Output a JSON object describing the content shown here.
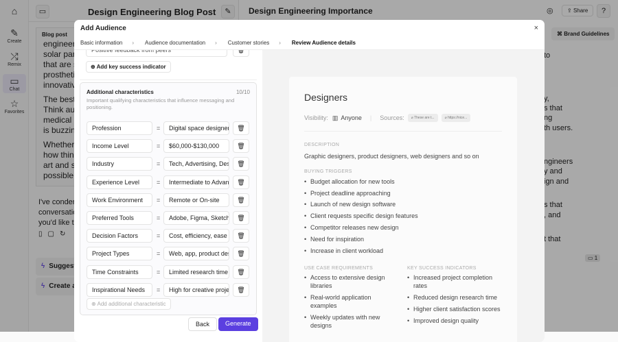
{
  "rail": [
    {
      "label": "",
      "icon": "home-icon",
      "glyph": "⌂"
    },
    {
      "label": "Create",
      "icon": "pen-icon",
      "glyph": "✎"
    },
    {
      "label": "Remix",
      "icon": "shuffle-icon",
      "glyph": "⤮"
    },
    {
      "label": "Chat",
      "icon": "chat-icon",
      "glyph": "💬"
    },
    {
      "label": "Favorites",
      "icon": "star-icon",
      "glyph": "☆"
    }
  ],
  "left_panel": {
    "title": "Design Engineering Blog Post",
    "blog_label": "Blog post",
    "paragraphs": [
      "engineers\nsolar pane\nthat are su\nprosthetic\ninnovative",
      "The best p\nThink auto\nmedical de\nis buzzing",
      "Whether y\nhow thing\nart and sc\npossible!"
    ],
    "chat_text": "I've conden\nconversatio\nyou'd like to",
    "suggestions": [
      "Suggest",
      "Create ar"
    ]
  },
  "right_panel": {
    "title": "Design Engineering Importance",
    "share": "Share",
    "brand_guidelines": "Brand Guidelines",
    "fragments": [
      "to",
      "y,",
      "s that",
      "ng",
      "th users.",
      "ngineers",
      "y and",
      "ign and",
      "s that",
      ", and",
      "t that"
    ],
    "comment_count": "1"
  },
  "modal": {
    "title": "Add Audience",
    "close": "×",
    "steps": [
      "Basic information",
      "Audience documentation",
      "Customer stories",
      "Review Audience details"
    ],
    "partial_indicator": "Positive feedback from peers",
    "add_indicator": "Add key success indicator",
    "additional": {
      "title": "Additional characteristics",
      "count": "10/10",
      "description": "Important qualifying characteristics that influence messaging and positioning.",
      "rows": [
        [
          "Profession",
          "Digital space designers"
        ],
        [
          "Income Level",
          "$60,000-$130,000"
        ],
        [
          "Industry",
          "Tech, Advertising, Design"
        ],
        [
          "Experience Level",
          "Intermediate to Advanced"
        ],
        [
          "Work Environment",
          "Remote or On-site"
        ],
        [
          "Preferred Tools",
          "Adobe, Figma, Sketch"
        ],
        [
          "Decision Factors",
          "Cost, efficiency, ease of use"
        ],
        [
          "Project Types",
          "Web, app, product design"
        ],
        [
          "Time Constraints",
          "Limited research time"
        ],
        [
          "Inspirational Needs",
          "High for creative projects"
        ]
      ],
      "add_label": "Add additional characteristic"
    },
    "back": "Back",
    "generate": "Generate",
    "preview": {
      "name": "Designers",
      "visibility_label": "Visibility:",
      "visibility": "Anyone",
      "sources_label": "Sources:",
      "sources": [
        "These are t...",
        "https://nice..."
      ],
      "description_label": "DESCRIPTION",
      "description": "Graphic designers, product designers, web designers and so on",
      "triggers_label": "BUYING TRIGGERS",
      "triggers": [
        "Budget allocation for new tools",
        "Project deadline approaching",
        "Launch of new design software",
        "Client requests specific design features",
        "Competitor releases new design",
        "Need for inspiration",
        "Increase in client workload"
      ],
      "use_case_label": "USE CASE REQUIREMENTS",
      "use_cases": [
        "Access to extensive design libraries",
        "Real-world application examples",
        "Weekly updates with new designs"
      ],
      "ksi_label": "KEY SUCCESS INDICATORS",
      "ksi": [
        "Increased project completion rates",
        "Reduced design research time",
        "Higher client satisfaction scores",
        "Improved design quality"
      ]
    }
  },
  "colors": {
    "accent": "#5b3fe0"
  }
}
